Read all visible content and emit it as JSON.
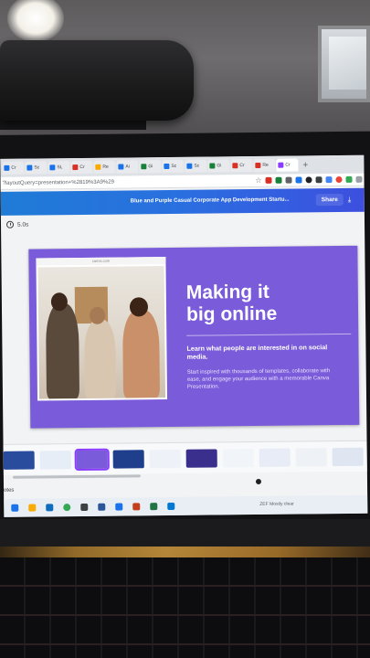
{
  "browser": {
    "tabs": [
      {
        "label": "Cr",
        "icon": "doc-icon"
      },
      {
        "label": "Sc",
        "icon": "doc-icon"
      },
      {
        "label": "SL",
        "icon": "doc-icon"
      },
      {
        "label": "Cr",
        "icon": "youtube-icon"
      },
      {
        "label": "Re",
        "icon": "star-icon"
      },
      {
        "label": "Ai",
        "icon": "doc-icon"
      },
      {
        "label": "Gi",
        "icon": "doc-icon"
      },
      {
        "label": "Sc",
        "icon": "doc-icon"
      },
      {
        "label": "Sc",
        "icon": "doc-icon"
      },
      {
        "label": "Gi",
        "icon": "doc-icon"
      },
      {
        "label": "Cr",
        "icon": "youtube-icon"
      },
      {
        "label": "Re",
        "icon": "youtube-icon"
      },
      {
        "label": "Cr",
        "icon": "doc-icon"
      }
    ],
    "new_tab": "+",
    "url": "?layoutQuery=presentation+%2819%3A9%29"
  },
  "canva": {
    "document_title": "Blue and Purple Casual Corporate App Development Startu...",
    "share_label": "Share",
    "timer": "5.0s"
  },
  "slide": {
    "title_line1": "Making it",
    "title_line2": "big online",
    "subtitle": "Learn what people are interested in on social media.",
    "body": "Start inspired with thousands of templates, collaborate with ease, and engage your audience with a memorable Canva Presentation.",
    "photo_caption": "canva.com"
  },
  "bottom": {
    "notes_label": "otes",
    "taskbar_search": "ZEF  Mostly clear"
  },
  "colors": {
    "header_blue": "#1f7bd6",
    "slide_purple": "#7a5bd9",
    "accent": "#8b3dff"
  }
}
